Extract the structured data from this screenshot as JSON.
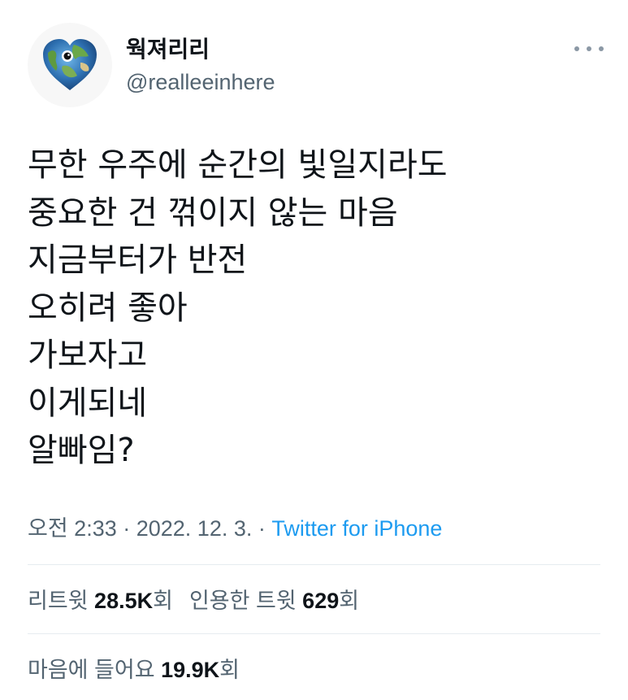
{
  "author": {
    "display_name": "웍져리리",
    "handle": "@realleeinhere",
    "avatar_icon": "earth-heart-icon"
  },
  "more_icon": "more-horizontal-icon",
  "tweet": {
    "lines": [
      "무한 우주에 순간의 빛일지라도",
      "중요한 건 꺾이지 않는 마음",
      "지금부터가 반전",
      "오히려 좋아",
      "가보자고",
      "이게되네",
      "알빠임?"
    ]
  },
  "meta": {
    "time": "오전 2:33",
    "separator1": " · ",
    "date": "2022. 12. 3.",
    "separator2": " · ",
    "source": "Twitter for iPhone"
  },
  "stats": {
    "retweets_label": "리트윗",
    "retweets_value": "28.5K",
    "retweets_unit": "회",
    "quotes_label": "인용한 트윗",
    "quotes_value": "629",
    "quotes_unit": "회",
    "likes_label": "마음에 들어요",
    "likes_value": "19.9K",
    "likes_unit": "회"
  },
  "colors": {
    "text_primary": "#0f1419",
    "text_secondary": "#536471",
    "link": "#1d9bf0",
    "divider": "#e6ecf0"
  }
}
